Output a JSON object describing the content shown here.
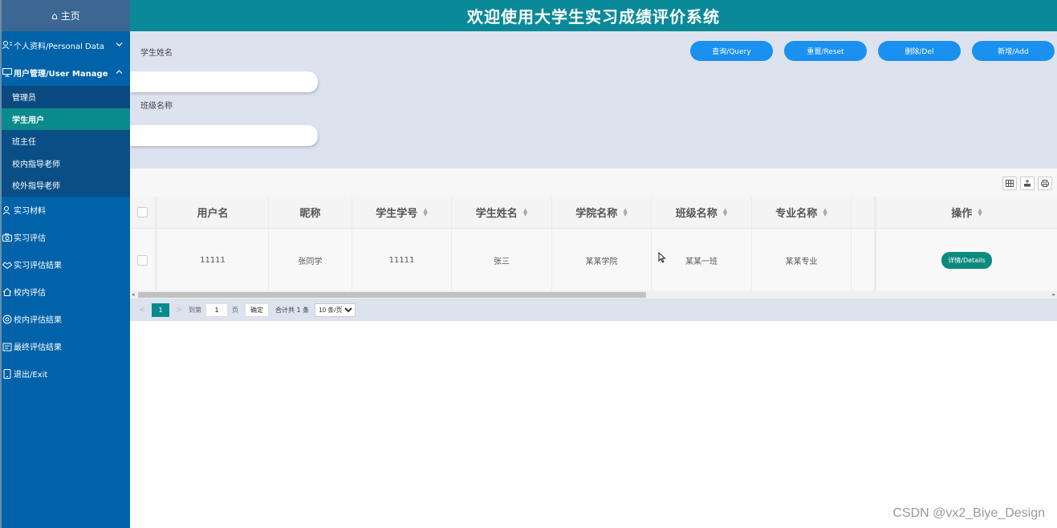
{
  "header": {
    "title": "欢迎使用大学生实习成绩评价系统"
  },
  "sidebar": {
    "home": "主页",
    "items": [
      {
        "label": "个人资料/Personal Data",
        "icon": "person-card-icon"
      },
      {
        "label": "用户管理/User Manage",
        "icon": "monitor-icon"
      },
      {
        "label": "实习材料",
        "icon": "person-icon"
      },
      {
        "label": "实习评估",
        "icon": "camera-icon"
      },
      {
        "label": "实习评估结果",
        "icon": "handshake-icon"
      },
      {
        "label": "校内评估",
        "icon": "home-icon"
      },
      {
        "label": "校内评估结果",
        "icon": "circle-icon"
      },
      {
        "label": "最终评估结果",
        "icon": "clipboard-icon"
      },
      {
        "label": "退出/Exit",
        "icon": "phone-icon"
      }
    ],
    "submenu": [
      "管理员",
      "学生用户",
      "班主任",
      "校内指导老师",
      "校外指导老师"
    ]
  },
  "search": {
    "student_name_label": "学生姓名",
    "class_name_label": "班级名称",
    "student_name_value": "",
    "class_name_value": "",
    "buttons": {
      "query": "查询/Query",
      "reset": "重置/Reset",
      "delete": "删除/Del",
      "add": "新增/Add"
    }
  },
  "table": {
    "columns": [
      "用户名",
      "昵称",
      "学生学号",
      "学生姓名",
      "学院名称",
      "班级名称",
      "专业名称",
      "",
      "操作"
    ],
    "rows": [
      {
        "cells": [
          "11111",
          "张同学",
          "11111",
          "张三",
          "某某学院",
          "某某一班",
          "某某专业",
          ""
        ],
        "action": "详情/Details"
      }
    ]
  },
  "pagination": {
    "prev": "<",
    "next": ">",
    "current_page": "1",
    "goto_prefix": "到第",
    "goto_value": "1",
    "goto_suffix": "页",
    "confirm": "确定",
    "total": "合计共 1 条",
    "page_size": "10 条/页"
  },
  "watermark": "CSDN @vx2_Biye_Design"
}
